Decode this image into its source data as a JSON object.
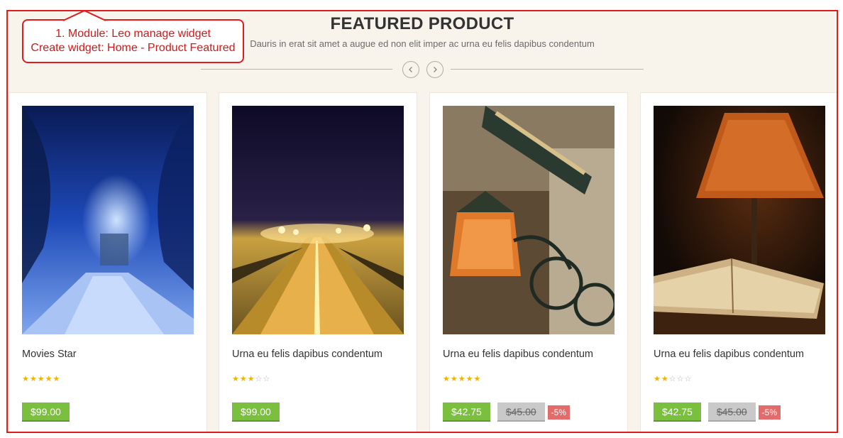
{
  "section": {
    "title": "FEATURED PRODUCT",
    "subtitle": "Dauris in erat sit amet a augue ed non elit imper ac urna eu felis dapibus condentum",
    "nav": {
      "prev_icon": "chevron-left-icon",
      "next_icon": "chevron-right-icon"
    }
  },
  "annotation": {
    "line1": "1. Module: Leo manage widget",
    "line2": "Create widget: Home - Product Featured",
    "color": "#e21c1c"
  },
  "products": [
    {
      "name": "Movies Star",
      "rating": 5,
      "price": "$99.00",
      "old_price": "",
      "discount": "",
      "image": "snowy-forest-path-night"
    },
    {
      "name": "Urna eu felis dapibus condentum",
      "rating": 3,
      "price": "$99.00",
      "old_price": "",
      "discount": "",
      "image": "road-with-street-lights-night"
    },
    {
      "name": "Urna eu felis dapibus condentum",
      "rating": 5,
      "price": "$42.75",
      "old_price": "$45.00",
      "discount": "-5%",
      "image": "street-lantern-sign"
    },
    {
      "name": "Urna eu felis dapibus condentum",
      "rating": 2,
      "price": "$42.75",
      "old_price": "$45.00",
      "discount": "-5%",
      "image": "lamp-and-open-book"
    }
  ],
  "colors": {
    "price_bg": "#7bbf3f",
    "old_price_bg": "#c9c9c9",
    "discount_bg": "#e36b6b",
    "star_on": "#f0b400",
    "section_bg": "#f8f4ec"
  }
}
